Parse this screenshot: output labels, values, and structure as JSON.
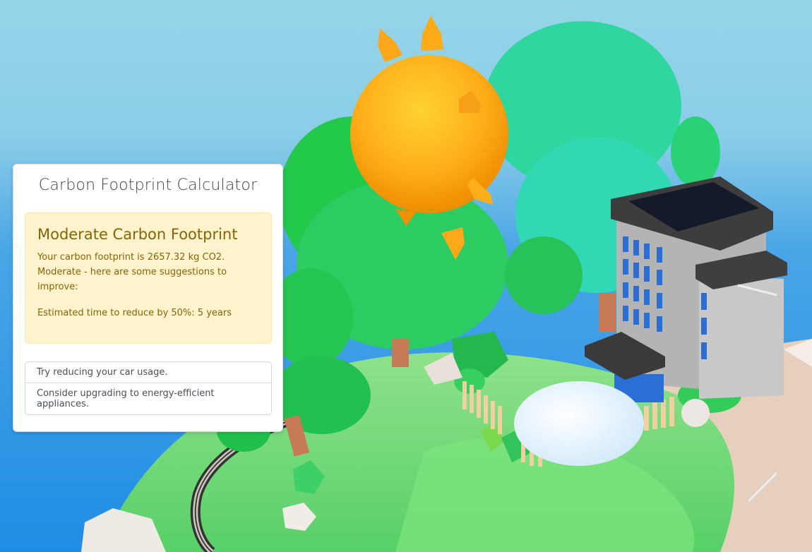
{
  "calculator": {
    "title": "Carbon Footprint Calculator",
    "result": {
      "heading": "Moderate Carbon Footprint",
      "footprint_text": "Your carbon footprint is 2657.32 kg CO2.",
      "category_text": "Moderate - here are some suggestions to improve:",
      "estimate_text": "Estimated time to reduce by 50%: 5 years"
    },
    "suggestions": [
      "Try reducing your car usage.",
      "Consider upgrading to energy-efficient appliances."
    ]
  },
  "colors": {
    "sky_top": "#93d4e8",
    "sky_bottom": "#2e8fe0",
    "grass": "#5fd36a",
    "tree_dark": "#2fd36e",
    "tree_teal": "#29d9a4",
    "sun": "#ffa51a",
    "building": "#a9a9a9",
    "window": "#2a6fd6",
    "alert_bg": "#fff3cd",
    "alert_text": "#856404"
  }
}
